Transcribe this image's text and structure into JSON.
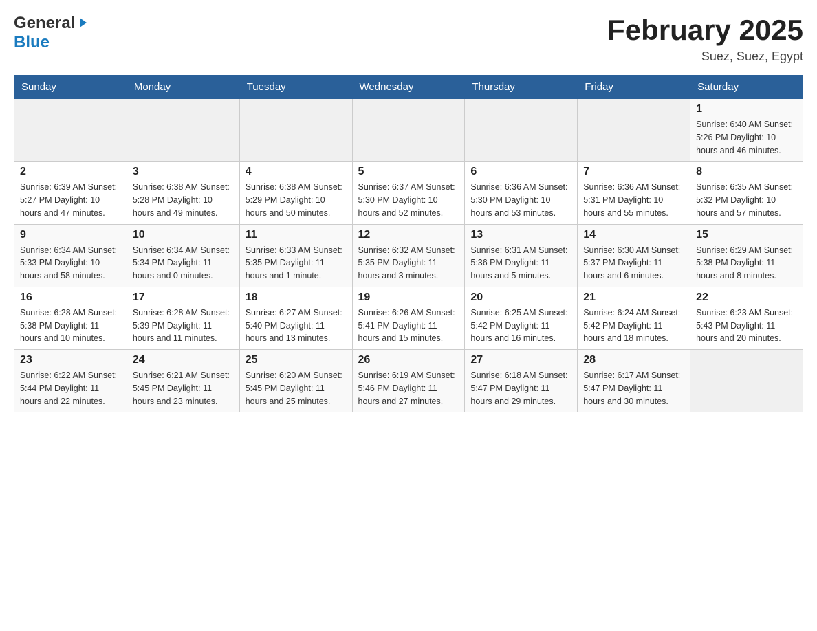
{
  "header": {
    "logo_general": "General",
    "logo_blue": "Blue",
    "title": "February 2025",
    "location": "Suez, Suez, Egypt"
  },
  "days_of_week": [
    "Sunday",
    "Monday",
    "Tuesday",
    "Wednesday",
    "Thursday",
    "Friday",
    "Saturday"
  ],
  "weeks": [
    [
      {
        "day": "",
        "info": ""
      },
      {
        "day": "",
        "info": ""
      },
      {
        "day": "",
        "info": ""
      },
      {
        "day": "",
        "info": ""
      },
      {
        "day": "",
        "info": ""
      },
      {
        "day": "",
        "info": ""
      },
      {
        "day": "1",
        "info": "Sunrise: 6:40 AM\nSunset: 5:26 PM\nDaylight: 10 hours\nand 46 minutes."
      }
    ],
    [
      {
        "day": "2",
        "info": "Sunrise: 6:39 AM\nSunset: 5:27 PM\nDaylight: 10 hours\nand 47 minutes."
      },
      {
        "day": "3",
        "info": "Sunrise: 6:38 AM\nSunset: 5:28 PM\nDaylight: 10 hours\nand 49 minutes."
      },
      {
        "day": "4",
        "info": "Sunrise: 6:38 AM\nSunset: 5:29 PM\nDaylight: 10 hours\nand 50 minutes."
      },
      {
        "day": "5",
        "info": "Sunrise: 6:37 AM\nSunset: 5:30 PM\nDaylight: 10 hours\nand 52 minutes."
      },
      {
        "day": "6",
        "info": "Sunrise: 6:36 AM\nSunset: 5:30 PM\nDaylight: 10 hours\nand 53 minutes."
      },
      {
        "day": "7",
        "info": "Sunrise: 6:36 AM\nSunset: 5:31 PM\nDaylight: 10 hours\nand 55 minutes."
      },
      {
        "day": "8",
        "info": "Sunrise: 6:35 AM\nSunset: 5:32 PM\nDaylight: 10 hours\nand 57 minutes."
      }
    ],
    [
      {
        "day": "9",
        "info": "Sunrise: 6:34 AM\nSunset: 5:33 PM\nDaylight: 10 hours\nand 58 minutes."
      },
      {
        "day": "10",
        "info": "Sunrise: 6:34 AM\nSunset: 5:34 PM\nDaylight: 11 hours\nand 0 minutes."
      },
      {
        "day": "11",
        "info": "Sunrise: 6:33 AM\nSunset: 5:35 PM\nDaylight: 11 hours\nand 1 minute."
      },
      {
        "day": "12",
        "info": "Sunrise: 6:32 AM\nSunset: 5:35 PM\nDaylight: 11 hours\nand 3 minutes."
      },
      {
        "day": "13",
        "info": "Sunrise: 6:31 AM\nSunset: 5:36 PM\nDaylight: 11 hours\nand 5 minutes."
      },
      {
        "day": "14",
        "info": "Sunrise: 6:30 AM\nSunset: 5:37 PM\nDaylight: 11 hours\nand 6 minutes."
      },
      {
        "day": "15",
        "info": "Sunrise: 6:29 AM\nSunset: 5:38 PM\nDaylight: 11 hours\nand 8 minutes."
      }
    ],
    [
      {
        "day": "16",
        "info": "Sunrise: 6:28 AM\nSunset: 5:38 PM\nDaylight: 11 hours\nand 10 minutes."
      },
      {
        "day": "17",
        "info": "Sunrise: 6:28 AM\nSunset: 5:39 PM\nDaylight: 11 hours\nand 11 minutes."
      },
      {
        "day": "18",
        "info": "Sunrise: 6:27 AM\nSunset: 5:40 PM\nDaylight: 11 hours\nand 13 minutes."
      },
      {
        "day": "19",
        "info": "Sunrise: 6:26 AM\nSunset: 5:41 PM\nDaylight: 11 hours\nand 15 minutes."
      },
      {
        "day": "20",
        "info": "Sunrise: 6:25 AM\nSunset: 5:42 PM\nDaylight: 11 hours\nand 16 minutes."
      },
      {
        "day": "21",
        "info": "Sunrise: 6:24 AM\nSunset: 5:42 PM\nDaylight: 11 hours\nand 18 minutes."
      },
      {
        "day": "22",
        "info": "Sunrise: 6:23 AM\nSunset: 5:43 PM\nDaylight: 11 hours\nand 20 minutes."
      }
    ],
    [
      {
        "day": "23",
        "info": "Sunrise: 6:22 AM\nSunset: 5:44 PM\nDaylight: 11 hours\nand 22 minutes."
      },
      {
        "day": "24",
        "info": "Sunrise: 6:21 AM\nSunset: 5:45 PM\nDaylight: 11 hours\nand 23 minutes."
      },
      {
        "day": "25",
        "info": "Sunrise: 6:20 AM\nSunset: 5:45 PM\nDaylight: 11 hours\nand 25 minutes."
      },
      {
        "day": "26",
        "info": "Sunrise: 6:19 AM\nSunset: 5:46 PM\nDaylight: 11 hours\nand 27 minutes."
      },
      {
        "day": "27",
        "info": "Sunrise: 6:18 AM\nSunset: 5:47 PM\nDaylight: 11 hours\nand 29 minutes."
      },
      {
        "day": "28",
        "info": "Sunrise: 6:17 AM\nSunset: 5:47 PM\nDaylight: 11 hours\nand 30 minutes."
      },
      {
        "day": "",
        "info": ""
      }
    ]
  ]
}
